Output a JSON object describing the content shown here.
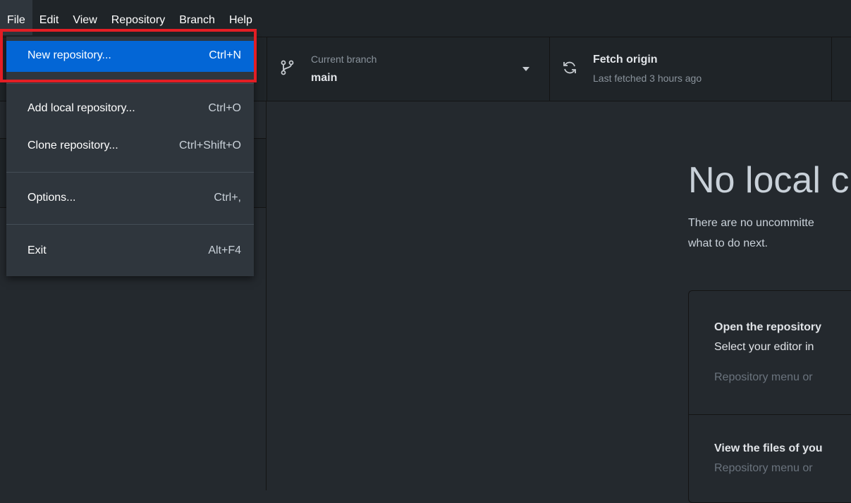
{
  "menubar": {
    "items": [
      {
        "label": "File"
      },
      {
        "label": "Edit"
      },
      {
        "label": "View"
      },
      {
        "label": "Repository"
      },
      {
        "label": "Branch"
      },
      {
        "label": "Help"
      }
    ]
  },
  "file_menu": {
    "items": [
      {
        "label": "New repository...",
        "shortcut": "Ctrl+N"
      },
      {
        "label": "Add local repository...",
        "shortcut": "Ctrl+O"
      },
      {
        "label": "Clone repository...",
        "shortcut": "Ctrl+Shift+O"
      },
      {
        "label": "Options...",
        "shortcut": "Ctrl+,"
      },
      {
        "label": "Exit",
        "shortcut": "Alt+F4"
      }
    ]
  },
  "toolbar": {
    "branch_caption": "Current branch",
    "branch_name": "main",
    "fetch_title": "Fetch origin",
    "fetch_status": "Last fetched 3 hours ago"
  },
  "blank_slate": {
    "title": "No local c",
    "desc_line1": "There are no uncommitte",
    "desc_line2": "what to do next.",
    "card1_title": "Open the repository",
    "card1_line": "Select your editor in",
    "card1_hint": "Repository menu or",
    "card2_title": "View the files of you",
    "card2_hint": "Repository menu or"
  },
  "colors": {
    "accent": "#0366d6",
    "highlight": "#e31e24",
    "background": "#24292e"
  }
}
